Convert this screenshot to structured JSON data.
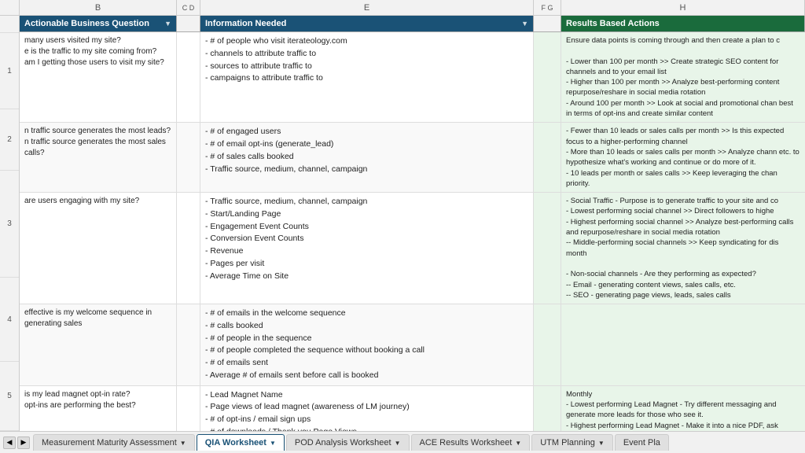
{
  "columns": {
    "b_label": "B",
    "cd_label": "C D",
    "e_label": "E",
    "fg_label": "F G",
    "h_label": "H"
  },
  "header": {
    "col_b": "Actionable Business Question",
    "col_e": "Information Needed",
    "col_h": "Results Based Actions",
    "filter_icon": "▼"
  },
  "rows": [
    {
      "b": "many users visited my site?\ne is the traffic to my site coming from?\nam I getting those users to visit my site?",
      "e": "- # of people who visit iterateology.com\n- channels to attribute traffic to\n- sources to attribute traffic to\n- campaigns to attribute traffic to",
      "h": "Ensure data points is coming through and then create a plan to c\n\n- Lower than 100 per month >> Create strategic SEO content for channels and to your email list\n- Higher than 100 per month >> Analyze best-performing content repurpose/reshare in social media rotation\n- Around 100 per month >> Look at social and promotional chan best in terms of opt-ins and create similar content"
    },
    {
      "b": "n traffic source generates the most leads?\nn traffic source generates the most sales calls?",
      "e": "- # of engaged users\n- # of email opt-ins (generate_lead)\n- # of sales calls booked\n- Traffic source, medium, channel, campaign",
      "h": "- Fewer than 10 leads or sales calls per month >> Is this expected focus to a higher-performing channel\n- More than 10 leads or sales calls per month >> Analyze chann etc. to hypothesize what's working and continue or do more of it.\n- 10 leads per month or sales calls >> Keep leveraging the chan priority."
    },
    {
      "b": "are users engaging with my site?",
      "e": "- Traffic source, medium, channel, campaign\n- Start/Landing Page\n- Engagement Event Counts\n- Conversion Event Counts\n- Revenue\n- Pages per visit\n- Average Time on Site",
      "h": "- Social Traffic - Purpose is to generate traffic to your site and co\n- Lowest performing social channel >> Direct followers to highe\n- Highest performing social channel >> Analyze best-performing calls and repurpose/reshare in social media rotation\n-- Middle-performing social channels >> Keep syndicating for dis month\n\n- Non-social channels - Are they performing as expected?\n-- Email - generating content views, sales calls, etc.\n-- SEO - generating page views, leads, sales calls"
    },
    {
      "b": "effective is my welcome sequence in generating sales",
      "e": "- # of emails in the welcome sequence\n- # calls booked\n- # of people in the sequence\n- # of people completed the sequence without booking a call\n- # of emails sent\n- Average # of emails sent before call is booked",
      "h": ""
    },
    {
      "b": "is my lead magnet opt-in rate?\nopt-ins are performing the best?",
      "e": "- Lead Magnet Name\n- Page views of lead magnet (awareness of LM journey)\n- # of opt-ins / email sign ups\n- # of downloads / Thank you Page Views",
      "h": "Monthly\n- Lowest performing Lead Magnet - Try different messaging and generate more leads for those who see it.\n- Highest performing Lead Magnet - Make it into a nice PDF, ask\n- Highest performing Lead Magnet - Make it into a nice PDF, ask"
    }
  ],
  "tabs": [
    {
      "id": "measurement",
      "label": "Measurement Maturity Assessment",
      "active": false
    },
    {
      "id": "qia",
      "label": "QIA Worksheet",
      "active": true
    },
    {
      "id": "pod",
      "label": "POD Analysis Worksheet",
      "active": false
    },
    {
      "id": "ace",
      "label": "ACE Results Worksheet",
      "active": false
    },
    {
      "id": "utm",
      "label": "UTM Planning",
      "active": false
    },
    {
      "id": "event",
      "label": "Event Pla",
      "active": false
    }
  ]
}
